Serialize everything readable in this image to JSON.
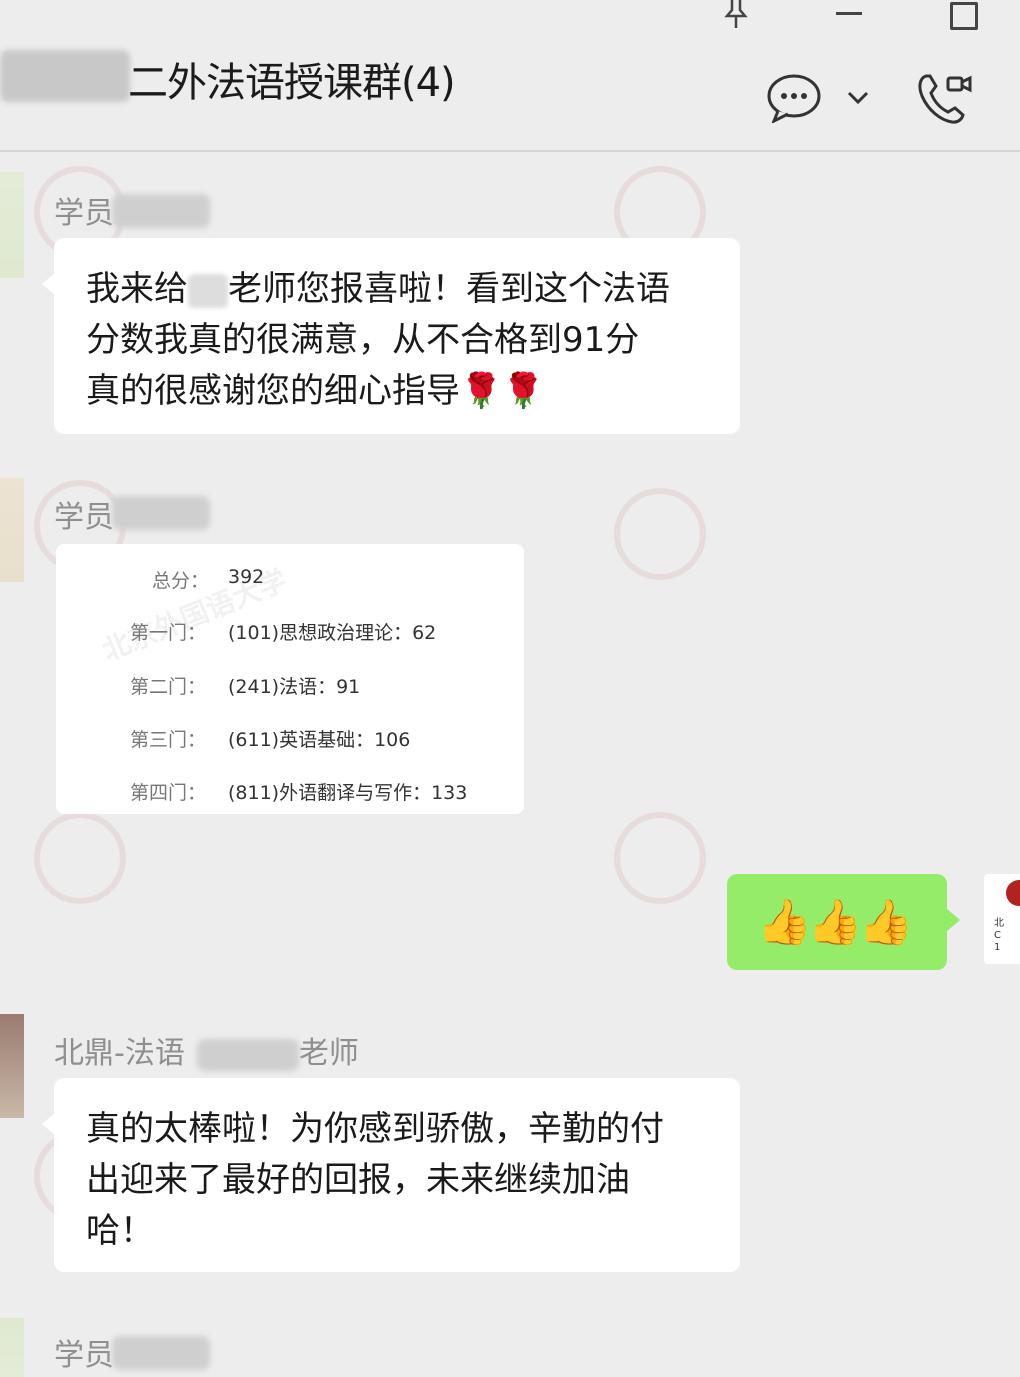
{
  "header": {
    "group_title": "二外法语授课群(4)"
  },
  "icons": {
    "pin": "pin-icon",
    "minimize": "minimize-icon",
    "maximize": "maximize-icon",
    "chat_info": "chat-info-icon",
    "dropdown": "chevron-down-icon",
    "call": "call-icon"
  },
  "messages": [
    {
      "sender": "学员",
      "text_line1_a": "我来给",
      "text_line1_b": "老师您报喜啦！看到这个法语",
      "text_line2": "分数我真的很满意，从不合格到91分",
      "text_line3": "真的很感谢您的细心指导🌹🌹"
    },
    {
      "sender": "学员",
      "scores": [
        {
          "label": "总分：",
          "value": "392"
        },
        {
          "label": "第一门：",
          "value": "(101)思想政治理论：62"
        },
        {
          "label": "第二门：",
          "value": "(241)法语：91"
        },
        {
          "label": "第三门：",
          "value": "(611)英语基础：106"
        },
        {
          "label": "第四门：",
          "value": "(811)外语翻译与写作：133"
        }
      ]
    },
    {
      "sender": "me",
      "text": "👍👍👍"
    },
    {
      "sender_prefix": "北鼎-法语",
      "sender_suffix": "老师",
      "text_line1": "真的太棒啦！为你感到骄傲，辛勤的付",
      "text_line2": "出迎来了最好的回报，未来继续加油",
      "text_line3": "哈！"
    },
    {
      "sender": "学员"
    }
  ],
  "colors": {
    "background": "#ededed",
    "bubble_white": "#ffffff",
    "bubble_green": "#95ec69"
  }
}
